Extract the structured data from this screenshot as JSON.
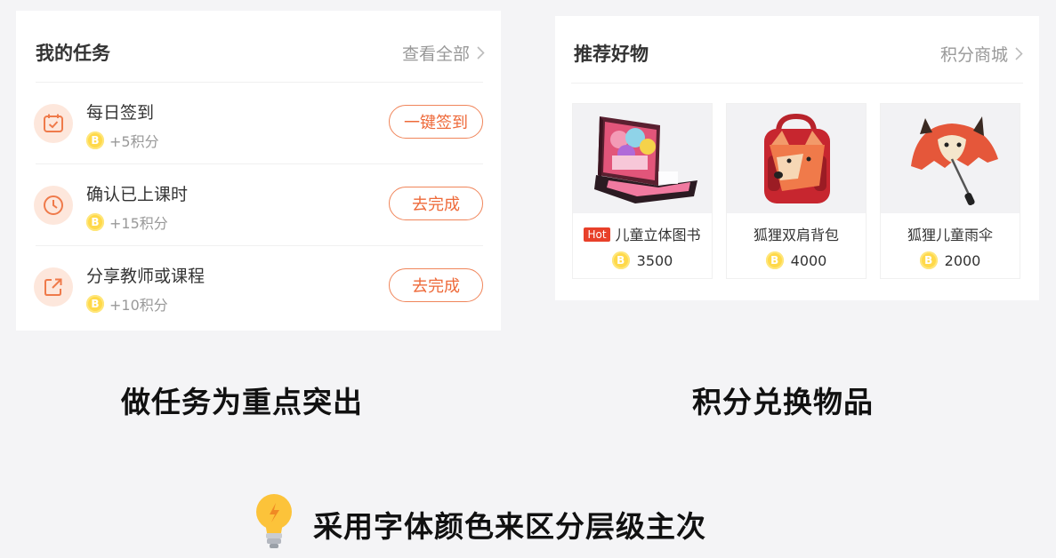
{
  "tasks_card": {
    "title": "我的任务",
    "view_all": "查看全部",
    "items": [
      {
        "name": "每日签到",
        "coin": "B",
        "points": "+5积分",
        "button": "一键签到",
        "icon": "calendar-check-icon"
      },
      {
        "name": "确认已上课时",
        "coin": "B",
        "points": "+15积分",
        "button": "去完成",
        "icon": "clock-icon"
      },
      {
        "name": "分享教师或课程",
        "coin": "B",
        "points": "+10积分",
        "button": "去完成",
        "icon": "share-icon"
      }
    ]
  },
  "shop_card": {
    "title": "推荐好物",
    "link": "积分商城",
    "products": [
      {
        "badge": "Hot",
        "name": "儿童立体图书",
        "coin": "B",
        "price": "3500",
        "image": "popup-book-image"
      },
      {
        "name": "狐狸双肩背包",
        "coin": "B",
        "price": "4000",
        "image": "fox-backpack-image"
      },
      {
        "name": "狐狸儿童雨伞",
        "coin": "B",
        "price": "2000",
        "image": "fox-umbrella-image"
      }
    ]
  },
  "captions": {
    "left": "做任务为重点突出",
    "right": "积分兑换物品",
    "bottom": "采用字体颜色来区分层级主次"
  },
  "colors": {
    "accent": "#ee6a3a",
    "icon_bg": "#fde7dc",
    "coin": "#ffd94a",
    "hot": "#e8402a",
    "background": "#f4f4f6"
  }
}
